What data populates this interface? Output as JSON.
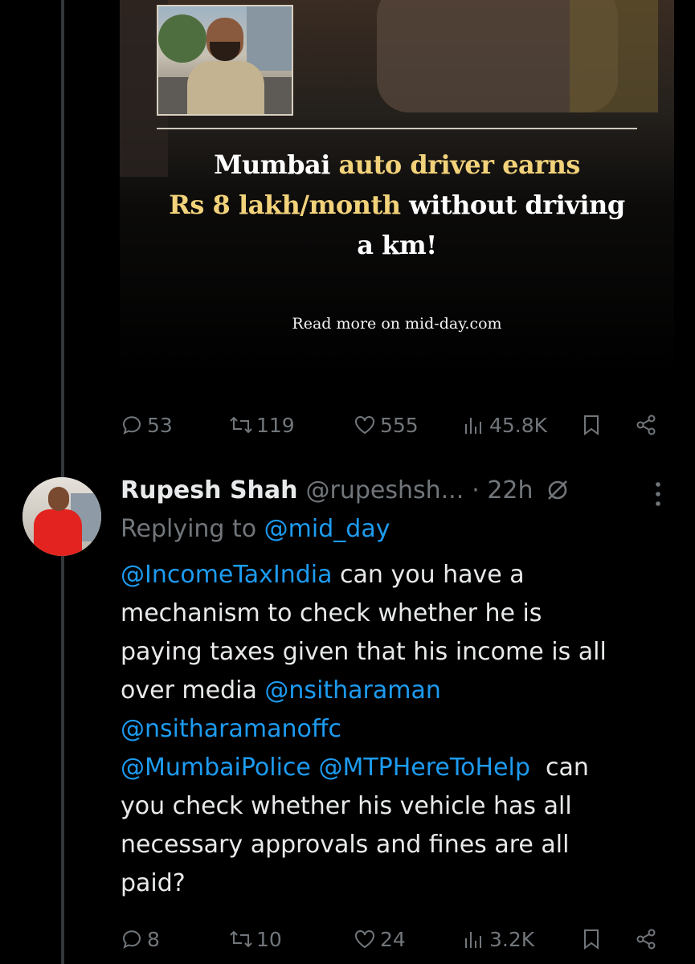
{
  "media": {
    "headline_part1": "Mumbai ",
    "headline_highlight1": "auto driver earns",
    "headline_highlight2": "Rs 8 lakh/month",
    "headline_part2": " without driving",
    "headline_part3": "a km!",
    "read_more": "Read more on mid-day.com"
  },
  "tweet_actions": {
    "replies": "53",
    "reposts": "119",
    "likes": "555",
    "views": "45.8K"
  },
  "reply": {
    "name": "Rupesh Shah",
    "handle": "@rupeshsh...",
    "time": "· 22h",
    "replying_prefix": "Replying to ",
    "replying_to": "@mid_day",
    "line1_mention": "@IncomeTaxIndia",
    "line1_text": " can you have a",
    "line2": "mechanism to check whether he is",
    "line3": "paying taxes given that his income is all",
    "line4_text": "over media ",
    "line4_mention": "@nsitharaman",
    "line5_mention": "@nsitharamanoffc",
    "line6_mention1": "@MumbaiPolice",
    "line6_mention2": "@MTPHereToHelp",
    "line6_text": "  can",
    "line7": "you check whether his vehicle has all",
    "line8": "necessary approvals and fines are all",
    "line9": "paid?"
  },
  "reply_actions": {
    "replies": "8",
    "reposts": "10",
    "likes": "24",
    "views": "3.2K"
  },
  "icons": {
    "reply": "speech-bubble-icon",
    "repost": "repost-arrows-icon",
    "like": "heart-icon",
    "views": "bar-chart-icon",
    "bookmark": "bookmark-icon",
    "share": "share-icon",
    "grok": "grok-slash-icon",
    "more": "vertical-dots-icon"
  },
  "colors": {
    "background": "#000000",
    "text": "#e7e9ea",
    "secondary": "#71767b",
    "link": "#1d9bf0",
    "headline_highlight": "#f2d27a"
  }
}
